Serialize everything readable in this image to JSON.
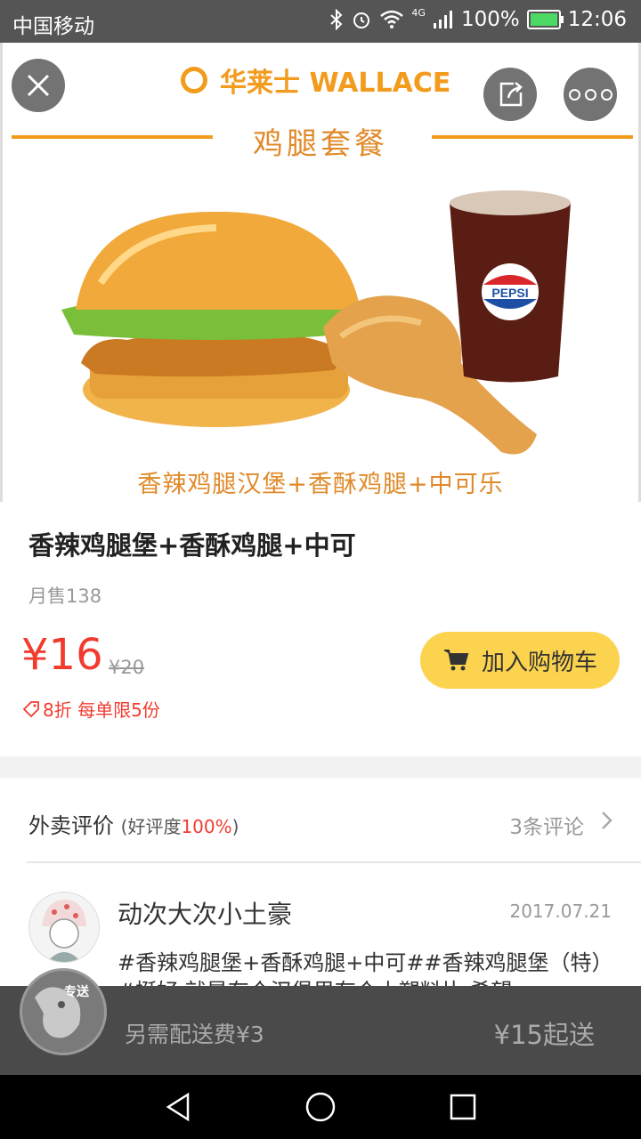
{
  "status_bar": {
    "carrier": "中国移动",
    "battery": "100%",
    "time": "12:06",
    "network": "4G"
  },
  "hero": {
    "brand_name": "华莱士 WALLACE",
    "subtitle": "鸡腿套餐",
    "caption": "香辣鸡腿汉堡+香酥鸡腿+中可乐"
  },
  "product": {
    "title": "香辣鸡腿堡+香酥鸡腿+中可",
    "monthly_sales": "月售138",
    "price": "¥16",
    "original_price": "¥20",
    "promo": "8折 每单限5份",
    "add_to_cart_label": "加入购物车"
  },
  "reviews": {
    "title": "外卖评价",
    "rating_prefix": "(好评度",
    "rating_value": "100%",
    "rating_suffix": ")",
    "count_label": "3条评论",
    "items": [
      {
        "user": "动次大次小土豪",
        "date": "2017.07.21",
        "text": "#香辣鸡腿堡+香酥鸡腿+中可##香辣鸡腿堡（特）#挺好,就是有个汉堡里有个小塑料片,希望"
      }
    ]
  },
  "bottom_bar": {
    "badge": "专送",
    "delivery_fee": "另需配送费¥3",
    "min_order": "¥15起送"
  },
  "colors": {
    "price_red": "#f23b2f",
    "cart_yellow": "#fcd34e",
    "brand_orange": "#f29b1d"
  }
}
